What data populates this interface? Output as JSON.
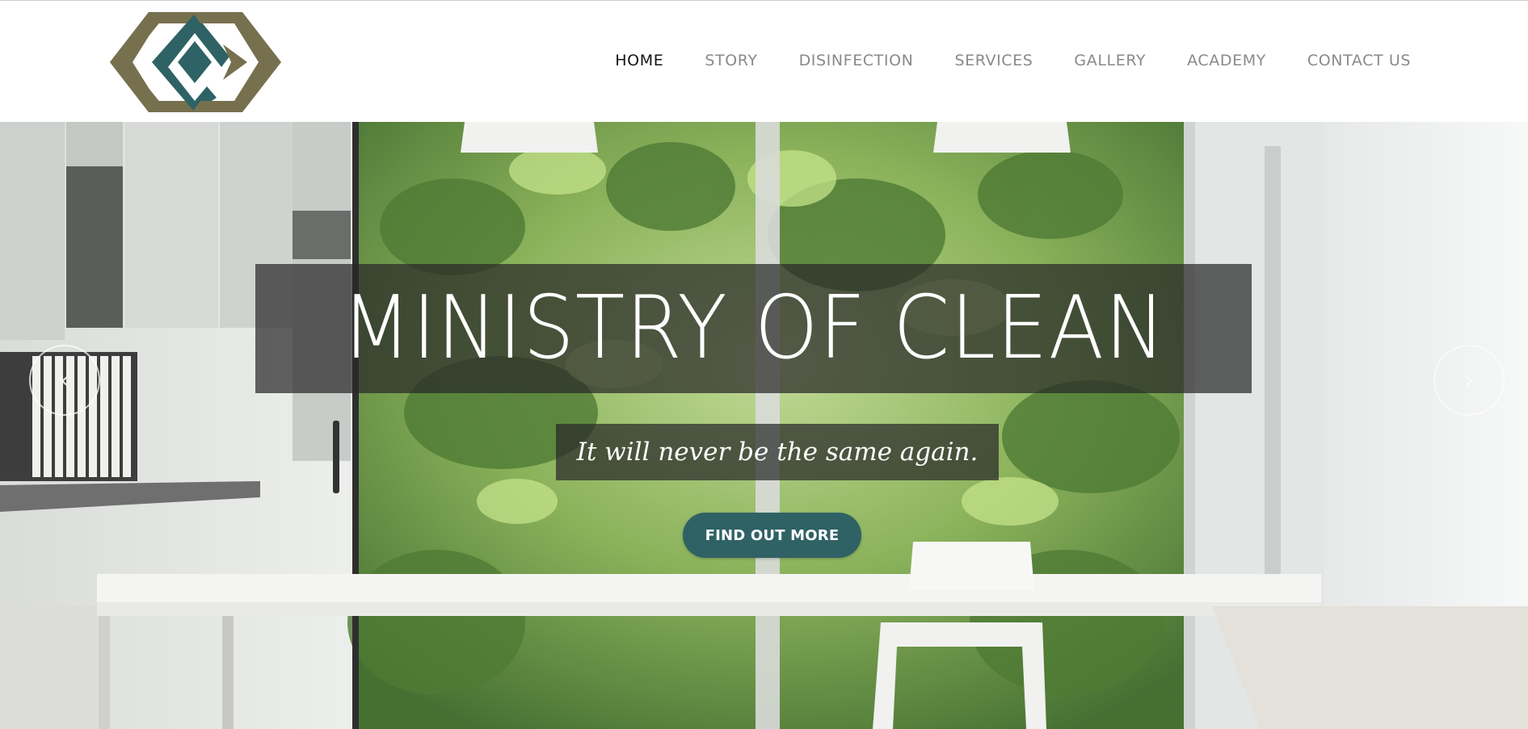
{
  "site": {
    "brand_colors": {
      "olive": "#77704f",
      "teal": "#2f6265",
      "nav_text": "#8a8a8a",
      "nav_active": "#151515"
    },
    "logo_icon": "interlocking-diamonds-logo"
  },
  "nav": {
    "items": [
      {
        "label": "HOME",
        "active": true
      },
      {
        "label": "STORY",
        "active": false
      },
      {
        "label": "DISINFECTION",
        "active": false
      },
      {
        "label": "SERVICES",
        "active": false
      },
      {
        "label": "GALLERY",
        "active": false
      },
      {
        "label": "ACADEMY",
        "active": false
      },
      {
        "label": "CONTACT US",
        "active": false
      }
    ]
  },
  "hero": {
    "title": "MINISTRY OF CLEAN",
    "tagline": "It will never be the same again.",
    "cta_label": "FIND OUT MORE",
    "prev_icon": "‹",
    "next_icon": "›"
  }
}
